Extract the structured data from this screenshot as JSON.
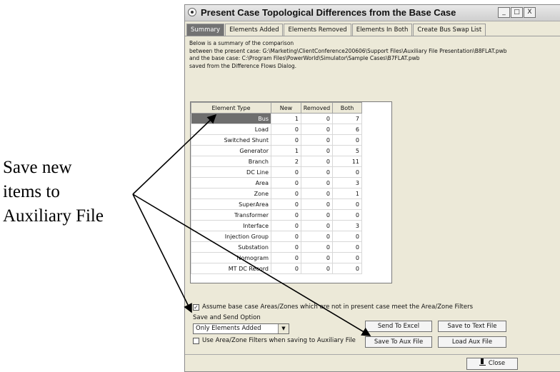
{
  "annotation": {
    "lines": [
      "Save new",
      "items to",
      "Auxiliary File"
    ]
  },
  "window": {
    "title": "Present Case Topological Differences from the Base Case",
    "min_glyph": "_",
    "max_glyph": "□",
    "close_glyph": "X"
  },
  "tabs": [
    {
      "label": "Summary"
    },
    {
      "label": "Elements Added"
    },
    {
      "label": "Elements Removed"
    },
    {
      "label": "Elements In Both"
    },
    {
      "label": "Create Bus Swap List"
    }
  ],
  "summary_lines": [
    "Below is a summary of the comparison",
    "between the present case: G:\\Marketing\\ClientConference200606\\Support Files\\Auxiliary File Presentation\\B8FLAT.pwb",
    "and the base case: C:\\Program Files\\PowerWorld\\Simulator\\Sample Cases\\B7FLAT.pwb",
    "saved from the Difference Flows Dialog."
  ],
  "table": {
    "headers": [
      "Element Type",
      "New",
      "Removed",
      "Both"
    ],
    "rows": [
      {
        "type": "Bus",
        "new": "1",
        "removed": "0",
        "both": "7"
      },
      {
        "type": "Load",
        "new": "0",
        "removed": "0",
        "both": "6"
      },
      {
        "type": "Switched Shunt",
        "new": "0",
        "removed": "0",
        "both": "0"
      },
      {
        "type": "Generator",
        "new": "1",
        "removed": "0",
        "both": "5"
      },
      {
        "type": "Branch",
        "new": "2",
        "removed": "0",
        "both": "11"
      },
      {
        "type": "DC Line",
        "new": "0",
        "removed": "0",
        "both": "0"
      },
      {
        "type": "Area",
        "new": "0",
        "removed": "0",
        "both": "3"
      },
      {
        "type": "Zone",
        "new": "0",
        "removed": "0",
        "both": "1"
      },
      {
        "type": "SuperArea",
        "new": "0",
        "removed": "0",
        "both": "0"
      },
      {
        "type": "Transformer",
        "new": "0",
        "removed": "0",
        "both": "0"
      },
      {
        "type": "Interface",
        "new": "0",
        "removed": "0",
        "both": "3"
      },
      {
        "type": "Injection Group",
        "new": "0",
        "removed": "0",
        "both": "0"
      },
      {
        "type": "Substation",
        "new": "0",
        "removed": "0",
        "both": "0"
      },
      {
        "type": "Nomogram",
        "new": "0",
        "removed": "0",
        "both": "0"
      },
      {
        "type": "MT DC Record",
        "new": "0",
        "removed": "0",
        "both": "0"
      }
    ]
  },
  "options": {
    "assume_base_label": "Assume base case Areas/Zones which are not in present case meet the Area/Zone Filters",
    "assume_base_checked": true,
    "save_send_label": "Save and Send Option",
    "save_send_value": "Only Elements Added",
    "use_filters_label": "Use Area/Zone Filters when saving to Auxiliary File",
    "use_filters_checked": false,
    "check_glyph": "✓"
  },
  "buttons": {
    "send_to_excel": "Send To Excel",
    "save_to_text": "Save to Text File",
    "save_to_aux": "Save To Aux File",
    "load_aux": "Load Aux File",
    "close": "Close"
  }
}
